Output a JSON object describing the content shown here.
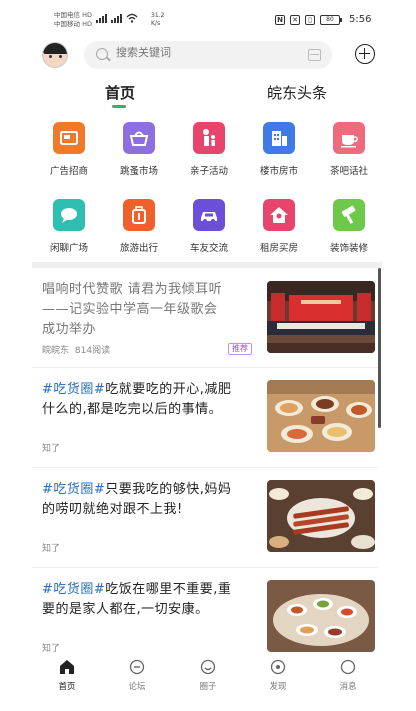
{
  "status_bar": {
    "carrier1": "中国电信 HD",
    "carrier2": "中国移动 HD",
    "net_speed_value": "31.2",
    "net_speed_unit": "K/s",
    "battery": "80",
    "time": "5:56"
  },
  "search": {
    "placeholder": "搜索关键词"
  },
  "tabs": [
    {
      "label": "首页",
      "active": true
    },
    {
      "label": "皖东头条",
      "active": false
    }
  ],
  "grid": [
    {
      "label": "广告招商",
      "icon": "advertising-icon",
      "color": "#f07a2a"
    },
    {
      "label": "跳蚤市场",
      "icon": "basket-icon",
      "color": "#8d6fe0"
    },
    {
      "label": "亲子活动",
      "icon": "parent-child-icon",
      "color": "#e8456c"
    },
    {
      "label": "楼市房市",
      "icon": "building-icon",
      "color": "#3f7be6"
    },
    {
      "label": "茶吧话社",
      "icon": "tea-cup-icon",
      "color": "#f06a7e"
    },
    {
      "label": "闲聊广场",
      "icon": "chat-bubble-icon",
      "color": "#2fbfb0"
    },
    {
      "label": "旅游出行",
      "icon": "suitcase-icon",
      "color": "#f0602a"
    },
    {
      "label": "车友交流",
      "icon": "car-icon",
      "color": "#6b4fd8"
    },
    {
      "label": "租房买房",
      "icon": "house-icon",
      "color": "#e8456c"
    },
    {
      "label": "装饰装修",
      "icon": "paint-roller-icon",
      "color": "#6ec84a"
    }
  ],
  "feed": [
    {
      "text_lines": [
        "唱响时代赞歌 请君为我倾耳听",
        "——记实验中学高一年级歌会",
        "成功举办"
      ],
      "source": "皖皖东",
      "reads": "814阅读",
      "badge": "推荐"
    },
    {
      "hashtag": "#吃货圈#",
      "text_lines": [
        "吃就要吃的开心,减肥",
        "什么的,都是吃完以后的事情。"
      ],
      "meta": "知了"
    },
    {
      "hashtag": "#吃货圈#",
      "text_lines": [
        "只要我吃的够快,妈妈",
        "的唠叨就绝对跟不上我!"
      ],
      "meta": "知了"
    },
    {
      "hashtag": "#吃货圈#",
      "text_lines": [
        "吃饭在哪里不重要,重",
        "要的是家人都在,一切安康。"
      ],
      "meta": "知了"
    }
  ],
  "bottom_nav": [
    {
      "label": "首页",
      "icon": "home-icon",
      "active": true
    },
    {
      "label": "论坛",
      "icon": "forum-icon",
      "active": false
    },
    {
      "label": "圈子",
      "icon": "circle-icon",
      "active": false
    },
    {
      "label": "发现",
      "icon": "discover-icon",
      "active": false
    },
    {
      "label": "消息",
      "icon": "message-icon",
      "active": false
    }
  ],
  "colors": {
    "accent": "#2fb36b",
    "hashtag": "#2a6db5",
    "badge": "#a050c8"
  }
}
